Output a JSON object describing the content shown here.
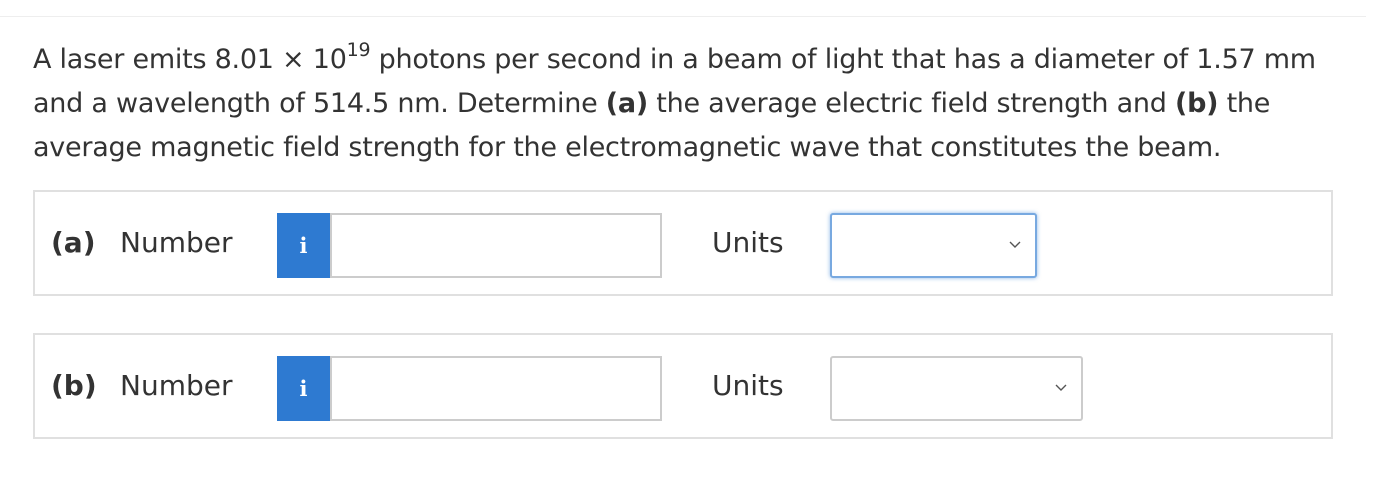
{
  "question": {
    "intro": "A laser emits 8.01 × 10",
    "exponent": "19",
    "after_exponent": " photons per second in a beam of light that has a diameter of 1.57 mm and a wavelength of 514.5 nm. Determine ",
    "part_a_marker": "(a)",
    "part_a_text": " the average electric field strength and ",
    "part_b_marker": "(b)",
    "part_b_text": " the average magnetic field strength for the electromagnetic wave that constitutes the beam."
  },
  "answers": [
    {
      "part_label": "(a)",
      "number_label": "Number",
      "info_icon": "i",
      "number_value": "",
      "units_label": "Units",
      "units_value": ""
    },
    {
      "part_label": "(b)",
      "number_label": "Number",
      "info_icon": "i",
      "number_value": "",
      "units_label": "Units",
      "units_value": ""
    }
  ],
  "icons": {
    "info": "info-icon",
    "dropdown": "chevron-down-icon"
  },
  "colors": {
    "info_button": "#2e7ad1",
    "focus_border": "#78a9e0",
    "box_border": "#e0e0e0",
    "text": "#333333"
  }
}
